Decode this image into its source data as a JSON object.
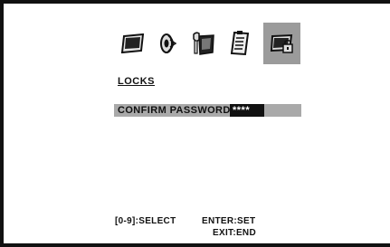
{
  "menu": {
    "icons": [
      {
        "name": "picture-icon",
        "selected": false
      },
      {
        "name": "audio-icon",
        "selected": false
      },
      {
        "name": "setup-icon",
        "selected": false
      },
      {
        "name": "document-icon",
        "selected": false
      },
      {
        "name": "locks-icon",
        "selected": true
      }
    ],
    "selected_color": "#9b9b9b"
  },
  "locks": {
    "title": "LOCKS",
    "confirm_label": "CONFIRM PASSWORD",
    "password_mask": "****"
  },
  "footer": {
    "select_hint": "[0-9]:SELECT",
    "enter_hint": "ENTER:SET",
    "exit_hint": "EXIT:END"
  }
}
